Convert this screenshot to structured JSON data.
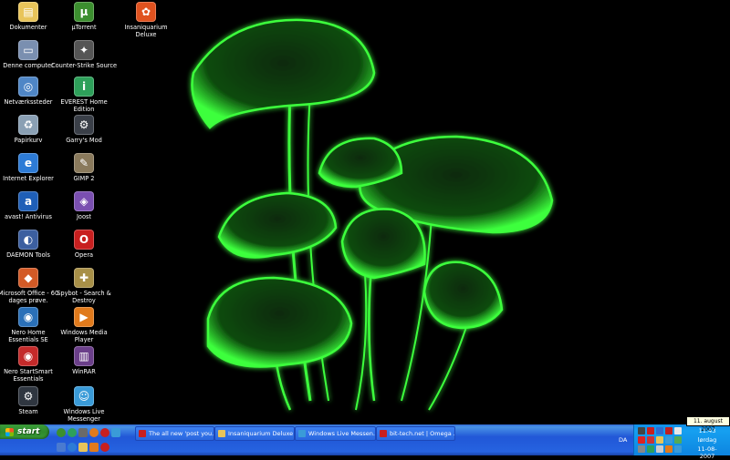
{
  "desktop": {
    "icons": [
      {
        "label": "Dokumenter",
        "icon": "folder-documents-icon",
        "color": "#e8c45a",
        "glyph": "▤"
      },
      {
        "label": "Denne computer",
        "icon": "my-computer-icon",
        "color": "#7a8fb0",
        "glyph": "▭"
      },
      {
        "label": "Netværkssteder",
        "icon": "network-places-icon",
        "color": "#4f86c6",
        "glyph": "◎"
      },
      {
        "label": "Papirkurv",
        "icon": "recycle-bin-icon",
        "color": "#8aa0b4",
        "glyph": "♻"
      },
      {
        "label": "Internet Explorer",
        "icon": "internet-explorer-icon",
        "color": "#2d7bd6",
        "glyph": "e"
      },
      {
        "label": "avast! Antivirus",
        "icon": "avast-antivirus-icon",
        "color": "#1f5fb7",
        "glyph": "a"
      },
      {
        "label": "DAEMON Tools",
        "icon": "daemon-tools-icon",
        "color": "#3c5fa0",
        "glyph": "◐"
      },
      {
        "label": "Microsoft Office - 60 dages prøve.",
        "icon": "microsoft-office-icon",
        "color": "#d35a26",
        "glyph": "◆"
      },
      {
        "label": "Nero Home Essentials SE",
        "icon": "nero-home-icon",
        "color": "#2a70b8",
        "glyph": "◉"
      },
      {
        "label": "Nero StartSmart Essentials",
        "icon": "nero-startsmart-icon",
        "color": "#c42a2a",
        "glyph": "◉"
      },
      {
        "label": "Steam",
        "icon": "steam-icon",
        "color": "#2f3640",
        "glyph": "⚙"
      },
      {
        "label": "µTorrent",
        "icon": "utorrent-icon",
        "color": "#3c8f2f",
        "glyph": "µ"
      },
      {
        "label": "Counter-Strike Source",
        "icon": "counter-strike-icon",
        "color": "#555555",
        "glyph": "✦"
      },
      {
        "label": "EVEREST Home Edition",
        "icon": "everest-icon",
        "color": "#2ea05a",
        "glyph": "i"
      },
      {
        "label": "Garry's Mod",
        "icon": "garrys-mod-icon",
        "color": "#3a3f48",
        "glyph": "⚙"
      },
      {
        "label": "GIMP 2",
        "icon": "gimp-icon",
        "color": "#8a7a5c",
        "glyph": "✎"
      },
      {
        "label": "Joost",
        "icon": "joost-icon",
        "color": "#7a4fb0",
        "glyph": "◈"
      },
      {
        "label": "Opera",
        "icon": "opera-icon",
        "color": "#c81f1f",
        "glyph": "O"
      },
      {
        "label": "Spybot - Search & Destroy",
        "icon": "spybot-icon",
        "color": "#a89048",
        "glyph": "✚"
      },
      {
        "label": "Windows Media Player",
        "icon": "windows-media-player-icon",
        "color": "#e07a1c",
        "glyph": "▶"
      },
      {
        "label": "WinRAR",
        "icon": "winrar-icon",
        "color": "#6b3f8a",
        "glyph": "▥"
      },
      {
        "label": "Windows Live Messenger",
        "icon": "windows-live-messenger-icon",
        "color": "#3a9bd8",
        "glyph": "☺"
      },
      {
        "label": "Insaniquarium Deluxe",
        "icon": "insaniquarium-icon",
        "color": "#e0521f",
        "glyph": "✿"
      }
    ]
  },
  "taskbar": {
    "start_label": "start",
    "tasks": [
      {
        "label": "The all new 'post you...",
        "icon": "opera-task-icon",
        "color": "#c81f1f"
      },
      {
        "label": "Insaniquarium Deluxe",
        "icon": "folder-task-icon",
        "color": "#e8c45a"
      },
      {
        "label": "Windows Live Messen...",
        "icon": "messenger-task-icon",
        "color": "#3a9bd8"
      },
      {
        "label": "bit-tech.net | Omega ...",
        "icon": "opera-task-icon",
        "color": "#c81f1f"
      }
    ],
    "lang": "DA"
  },
  "tray": {
    "time": "11:43",
    "day": "lørdag",
    "date": "11-08-2007",
    "tooltip": "11. august 2007"
  }
}
